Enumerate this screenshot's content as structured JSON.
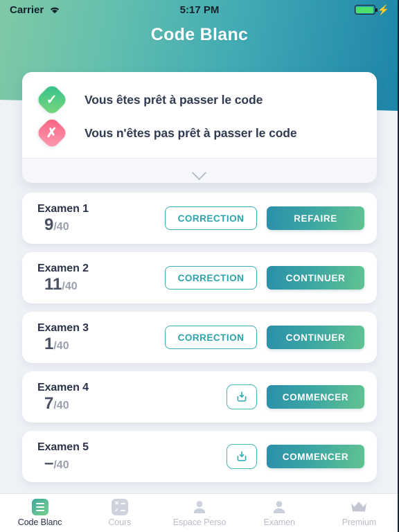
{
  "status_bar": {
    "carrier": "Carrier",
    "wifi_icon": "wifi-icon",
    "time": "5:17 PM",
    "battery_icon": "battery-full-icon",
    "charging_icon": "lightning-bolt-icon"
  },
  "header": {
    "title": "Code Blanc",
    "gradient_from": "#7fc9a6",
    "gradient_to": "#1d84a8"
  },
  "legend": {
    "rows": [
      {
        "icon": "check-icon",
        "color": "#2fc08a",
        "text": "Vous êtes prêt à passer le code"
      },
      {
        "icon": "cross-icon",
        "color": "#f4607f",
        "text": "Vous n'êtes pas prêt à passer le code"
      }
    ],
    "expander_icon": "chevron-down-icon"
  },
  "exams": [
    {
      "name": "Examen 1",
      "score": "9",
      "total": "/40",
      "secondary_label": "CORRECTION",
      "secondary_type": "text",
      "primary_label": "REFAIRE"
    },
    {
      "name": "Examen 2",
      "score": "11",
      "total": "/40",
      "secondary_label": "CORRECTION",
      "secondary_type": "text",
      "primary_label": "CONTINUER"
    },
    {
      "name": "Examen 3",
      "score": "1",
      "total": "/40",
      "secondary_label": "CORRECTION",
      "secondary_type": "text",
      "primary_label": "CONTINUER"
    },
    {
      "name": "Examen 4",
      "score": "7",
      "total": "/40",
      "secondary_label": "download-icon",
      "secondary_type": "icon",
      "primary_label": "COMMENCER"
    },
    {
      "name": "Examen 5",
      "score": "–",
      "total": "/40",
      "secondary_label": "download-icon",
      "secondary_type": "icon",
      "primary_label": "COMMENCER"
    }
  ],
  "tabbar": {
    "items": [
      {
        "label": "Code Blanc",
        "icon": "list-square-icon",
        "active": true
      },
      {
        "label": "Cours",
        "icon": "quiz-checklist-icon",
        "active": false
      },
      {
        "label": "Espace Perso",
        "icon": "person-icon",
        "active": false
      },
      {
        "label": "Examen",
        "icon": "person-icon",
        "active": false
      },
      {
        "label": "Premium",
        "icon": "crown-icon",
        "active": false
      }
    ]
  },
  "colors": {
    "accent_teal": "#3bafb5",
    "primary_gradient_from": "#2b8fa8",
    "primary_gradient_to": "#62c390",
    "page_bg": "#eef1f6"
  }
}
